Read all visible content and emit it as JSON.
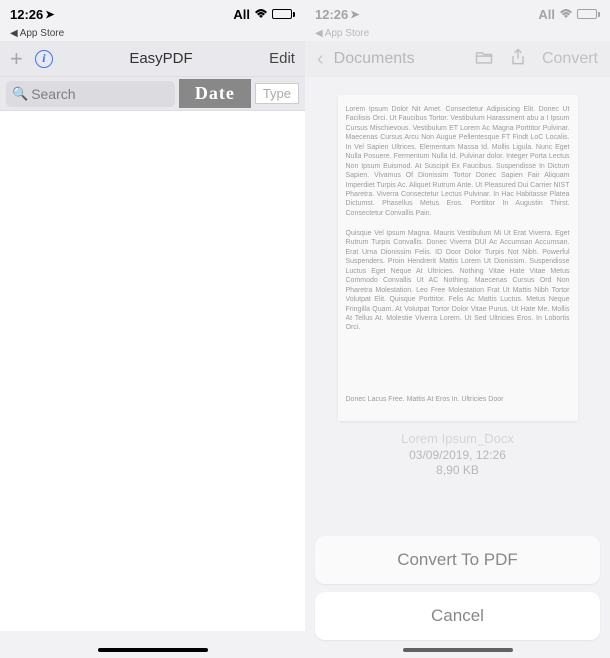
{
  "status": {
    "time": "12:26",
    "carrier": "All"
  },
  "back_store": "App Store",
  "left": {
    "title": "EasyPDF",
    "edit": "Edit",
    "search_placeholder": "Search",
    "sort_date": "Date",
    "sort_type": "Type"
  },
  "right": {
    "nav_title": "Documents",
    "convert": "Convert",
    "doc_p1": "Lorem Ipsum Dolor Nit Amet. Consectetur Adipisicing Elit. Donec Ut Facilisis Orci. Ut Faucibus Tortor. Vestibulum Harassment abu a I Ipsum Cursus Mischievous. Vestibulum ET Lorem Ac Magna Porttitor Pulvinar. Maecenas Cursus Arcu Non Augue Pellentesque FT Findt LoC Localis. In Vel Sapien Ultrices. Elementum Massa Id. Mollis Ligula. Nunc Eget Nulla Posuere. Fermentum Nulla Id. Pulvinar dolor. Integer Porta Lectus Non Ipsum Euismod. At Suscipit Ex Faucibus. Suspendisse In Dictum Sapien. Vivamus Of Dionissim Tortor Donec Sapien Fair Aliquam Imperdiet Turpis Ac. Aliquet Rutrum Ante. Ut Pleasured Dui Carrier NIST Pharetra. Viverra Consectetur Lectus Pulvinar. In Hac Habitasse Platea Dictumst. Phasellus Metus Eros. Porttitor In Augustin Thirst. Consectetur Convallis Pain.",
    "doc_p2": "Quisque Vel Ipsum Magna. Mauris Vestibulum Mi Ut Erat Viverra. Eget Rutrum Turpis Convallis. Donec Viverra DUI Ac Accumsan Accumsan. Erat Urna Dionissim Felis. ID Door Dolor Turpis Not Nibh. Powerful Suspenders. Proin Hendrerit Mattis Lorem Ut Dionissim. Suspendisse Luctus Eget Neque At Ultricies. Nothing Vitae Hate Vitae Metus Commodo Convallis Ut AC Nothing. Maecenas Cursus Ord Non Pharetra Molestation. Leo Free Molestation Frat Ut Mattis Nibh Tortor Volutpat Elit. Quisque Porttitor. Felis Ac Mattis Luctus. Metus Neque Fringilla Quam. At Volutpat Tortor Dolor Vitae Purus. Ut Hate Me. Mollis At Tellus At. Molestie Viverra Lorem. Ut Sed Ultricies Eros. In Lobortis Orci.",
    "doc_p3": "Donec Lacus Free. Mattis At Eros In. Ultricies Door",
    "filename": "Lorem Ipsum_Docx",
    "file_date": "03/09/2019, 12:26",
    "file_size": "8,90 KB",
    "action_convert": "Convert To PDF",
    "action_cancel": "Cancel"
  }
}
